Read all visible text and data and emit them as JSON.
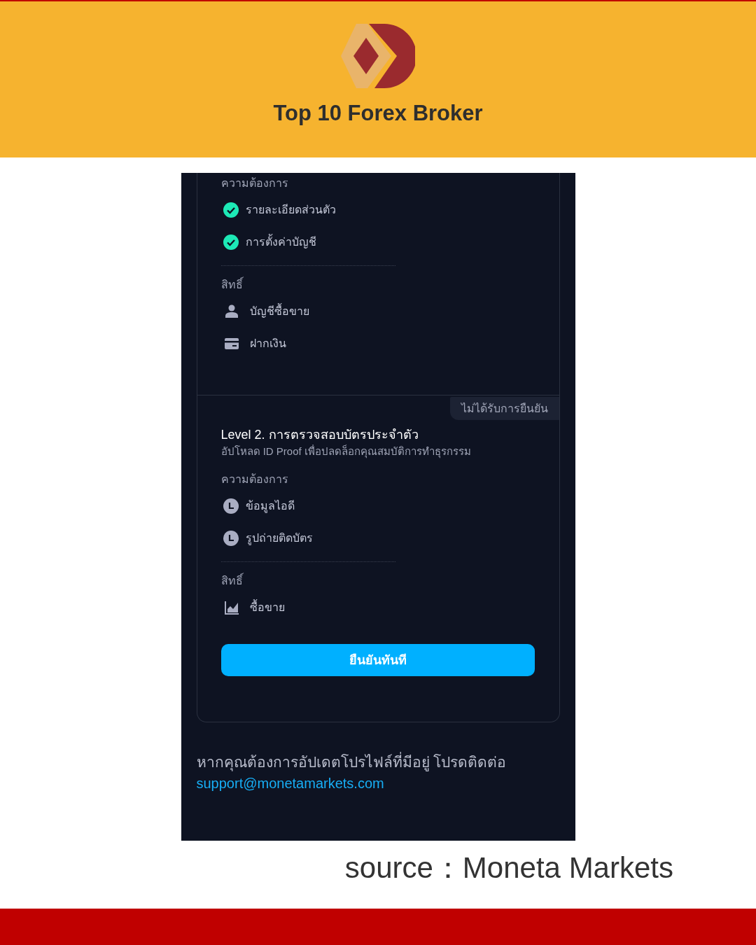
{
  "banner": {
    "title": "Top 10 Forex Broker"
  },
  "level_1": {
    "requirements_label": "ความต้องการ",
    "requirements": [
      {
        "label": "รายละเอียดส่วนตัว",
        "kind": "done"
      },
      {
        "label": "การตั้งค่าบัญชี",
        "kind": "done"
      }
    ],
    "permissions_label": "สิทธิ์",
    "permissions": [
      {
        "label": "บัญชีซื้อขาย",
        "kind": "person"
      },
      {
        "label": "ฝากเงิน",
        "kind": "card"
      }
    ]
  },
  "level_2": {
    "badge": "ไม่ได้รับการยืนยัน",
    "title": "Level 2. การตรวจสอบบัตรประจำตัว",
    "subtitle": "อัปโหลด ID Proof เพื่อปลดล็อกคุณสมบัติการทำธุรกรรม",
    "requirements_label": "ความต้องการ",
    "requirements": [
      {
        "label": "ข้อมูลไอดี",
        "kind": "pending"
      },
      {
        "label": "รูปถ่ายติดบัตร",
        "kind": "pending"
      }
    ],
    "permissions_label": "สิทธิ์",
    "permissions": [
      {
        "label": "ซื้อขาย",
        "kind": "chart"
      }
    ],
    "button": "ยืนยันทันที"
  },
  "contact": {
    "text": "หากคุณต้องการอัปเดตโปรไฟล์ที่มีอยู่ โปรดติดต่อ",
    "email": "support@monetamarkets.com"
  },
  "source": "source：Moneta Markets"
}
